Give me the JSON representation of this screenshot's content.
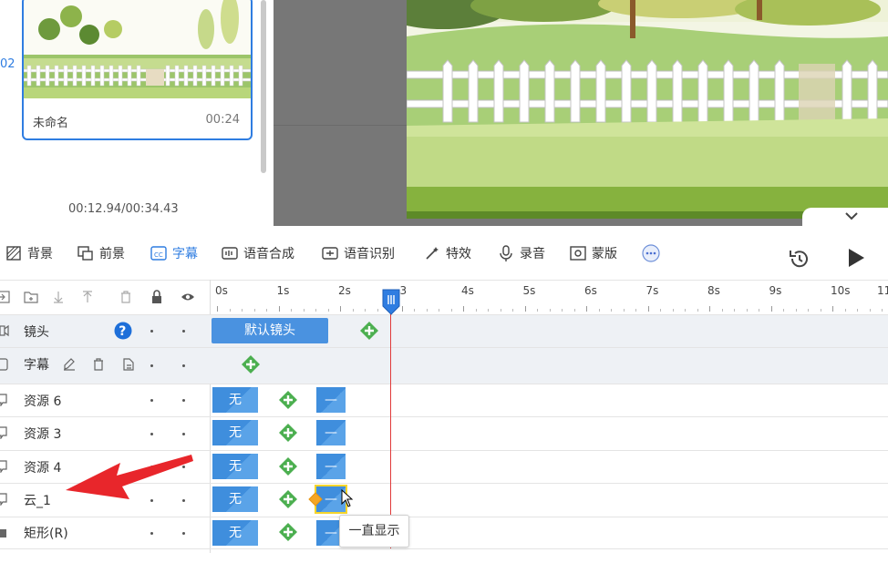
{
  "scene": {
    "index": "02",
    "name": "未命名",
    "duration": "00:24"
  },
  "time_readout": "00:12.94/00:34.43",
  "toolbar": {
    "items": [
      {
        "label": "背景",
        "icon": "background-icon"
      },
      {
        "label": "前景",
        "icon": "foreground-icon"
      },
      {
        "label": "字幕",
        "icon": "subtitle-icon",
        "active": true
      },
      {
        "label": "语音合成",
        "icon": "speech-synthesis-icon"
      },
      {
        "label": "语音识别",
        "icon": "speech-recognition-icon"
      },
      {
        "label": "特效",
        "icon": "effects-icon"
      },
      {
        "label": "录音",
        "icon": "microphone-icon"
      },
      {
        "label": "蒙版",
        "icon": "mask-icon"
      }
    ]
  },
  "ruler": {
    "ticks": [
      "0s",
      "1s",
      "2s",
      "3",
      "4s",
      "5s",
      "6s",
      "7s",
      "8s",
      "9s",
      "10s",
      "11"
    ]
  },
  "tracks": {
    "camera": {
      "label": "镜头",
      "block_label": "默认镜头"
    },
    "subtitle": {
      "label": "字幕"
    },
    "rows": [
      {
        "label": "资源 6",
        "block_none": "无",
        "block_dash": "—"
      },
      {
        "label": "资源 3",
        "block_none": "无",
        "block_dash": "—"
      },
      {
        "label": "资源 4",
        "block_none": "无",
        "block_dash": "—"
      },
      {
        "label": "云_1",
        "block_none": "无",
        "block_dash": "—"
      },
      {
        "label": "矩形(R)",
        "block_none": "无",
        "block_dash": "—"
      }
    ]
  },
  "tooltip": "一直显示",
  "colors": {
    "accent": "#2f7de1",
    "block": "#3f8edd",
    "add": "#4caf50",
    "playhead": "#e03a3a",
    "annotation_arrow": "#e8262b"
  }
}
